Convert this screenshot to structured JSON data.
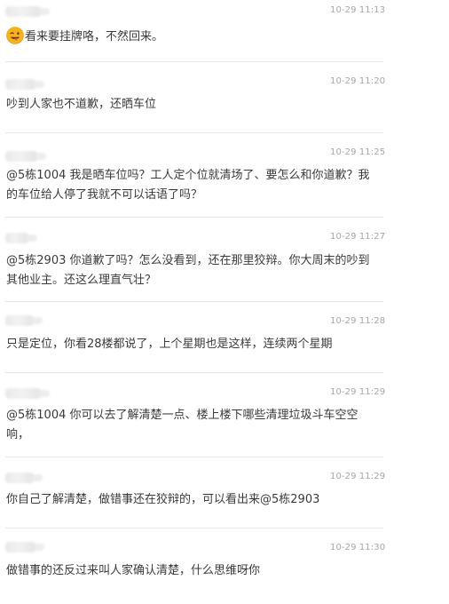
{
  "messages": [
    {
      "time": "10-29 11:13",
      "emoji": "winking-tongue-face",
      "text": "看来要挂牌咯，不然回来。"
    },
    {
      "time": "10-29 11:20",
      "text": "吵到人家也不道歉，还晒车位"
    },
    {
      "time": "10-29 11:25",
      "text": "@5栋1004 我是晒车位吗？工人定个位就清场了、要怎么和你道歉？我的车位给人停了我就不可以话语了吗？"
    },
    {
      "time": "10-29 11:27",
      "text": "@5栋2903 你道歉了吗？怎么没看到，还在那里狡辩。你大周末的吵到其他业主。还这么理直气壮？"
    },
    {
      "time": "10-29 11:28",
      "text": "只是定位，你看28楼都说了，上个星期也是这样，连续两个星期"
    },
    {
      "time": "10-29 11:29",
      "text": "@5栋1004 你可以去了解清楚一点、楼上楼下哪些清理垃圾斗车空空响，"
    },
    {
      "time": "10-29 11:29",
      "text": "你自己了解清楚，做错事还在狡辩的，可以看出来@5栋2903"
    },
    {
      "time": "10-29 11:30",
      "text": "做错事的还反过来叫人家确认清楚，什么思维呀你"
    }
  ],
  "colors": {
    "text": "#3a3a3a",
    "time": "#a6a6a6",
    "divider": "#e6e6e6",
    "emoji_face": "#f7b21b"
  }
}
